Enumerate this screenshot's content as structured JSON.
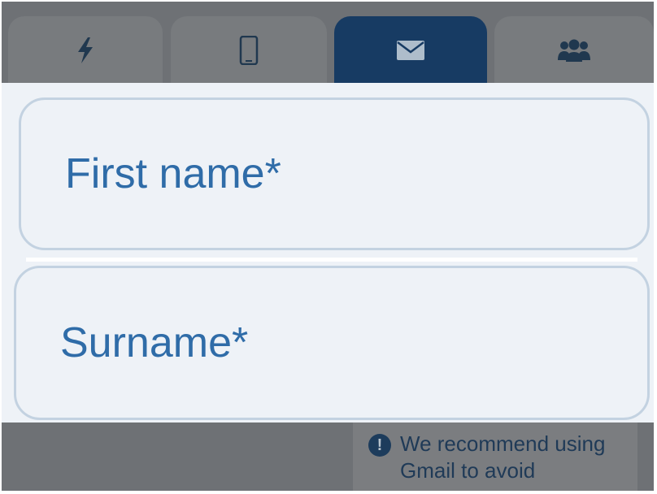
{
  "tabs": [
    {
      "id": "quick",
      "icon": "lightning-icon",
      "active": false
    },
    {
      "id": "phone",
      "icon": "mobile-phone-icon",
      "active": false
    },
    {
      "id": "email",
      "icon": "envelope-icon",
      "active": true
    },
    {
      "id": "group",
      "icon": "users-icon",
      "active": false
    }
  ],
  "form": {
    "first_name_label": "First name*",
    "surname_label": "Surname*"
  },
  "notice": {
    "icon": "info-icon",
    "icon_glyph": "!",
    "text": "We recommend using Gmail to avoid"
  },
  "colors": {
    "active_tab": "#173b63",
    "label_blue": "#2f6ca8",
    "field_border": "#c3d2e1"
  }
}
